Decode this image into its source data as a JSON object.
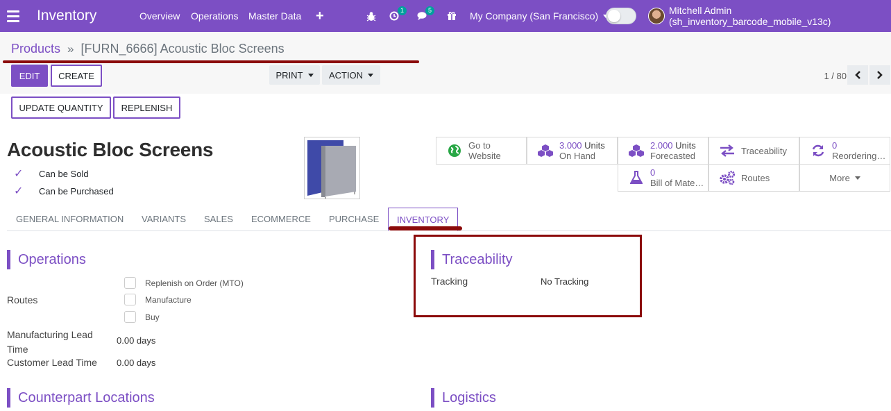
{
  "navbar": {
    "app_title": "Inventory",
    "menu": [
      "Overview",
      "Operations",
      "Master Data"
    ],
    "activity_badge": "1",
    "messages_badge": "5",
    "company": "My Company (San Francisco)",
    "user": "Mitchell Admin (sh_inventory_barcode_mobile_v13c)"
  },
  "breadcrumb": {
    "parent": "Products",
    "separator": "»",
    "current": "[FURN_6666] Acoustic Bloc Screens"
  },
  "toolbar": {
    "edit": "EDIT",
    "create": "CREATE",
    "print": "PRINT",
    "action": "ACTION",
    "pager": "1 / 80",
    "update_quantity": "UPDATE QUANTITY",
    "replenish": "REPLENISH"
  },
  "product": {
    "name": "Acoustic Bloc Screens",
    "can_be_sold": "Can be Sold",
    "can_be_purchased": "Can be Purchased"
  },
  "smart_buttons": {
    "website_l1": "Go to",
    "website_l2": "Website",
    "on_hand_num": "3.000",
    "on_hand_unit": "Units",
    "on_hand_label": "On Hand",
    "forecast_num": "2.000",
    "forecast_unit": "Units",
    "forecast_label": "Forecasted",
    "traceability": "Traceability",
    "reordering_num": "0",
    "reordering_label": "Reordering…",
    "bom_num": "0",
    "bom_label": "Bill of Mate…",
    "routes": "Routes",
    "more": "More"
  },
  "tabs": [
    "GENERAL INFORMATION",
    "VARIANTS",
    "SALES",
    "ECOMMERCE",
    "PURCHASE",
    "INVENTORY"
  ],
  "operations": {
    "title": "Operations",
    "routes_label": "Routes",
    "routes": [
      "Replenish on Order (MTO)",
      "Manufacture",
      "Buy"
    ],
    "mfg_lead_l1": "Manufacturing Lead",
    "mfg_lead_l2": "Time",
    "mfg_lead_value": "0.00 days",
    "cust_lead_label": "Customer Lead Time",
    "cust_lead_value": "0.00 days"
  },
  "traceability": {
    "title": "Traceability",
    "tracking_label": "Tracking",
    "tracking_value": "No Tracking"
  },
  "counterpart": {
    "title": "Counterpart Locations"
  },
  "logistics": {
    "title": "Logistics"
  },
  "colors": {
    "brand": "#7c4fc4",
    "annotation": "#8b0a0a"
  }
}
